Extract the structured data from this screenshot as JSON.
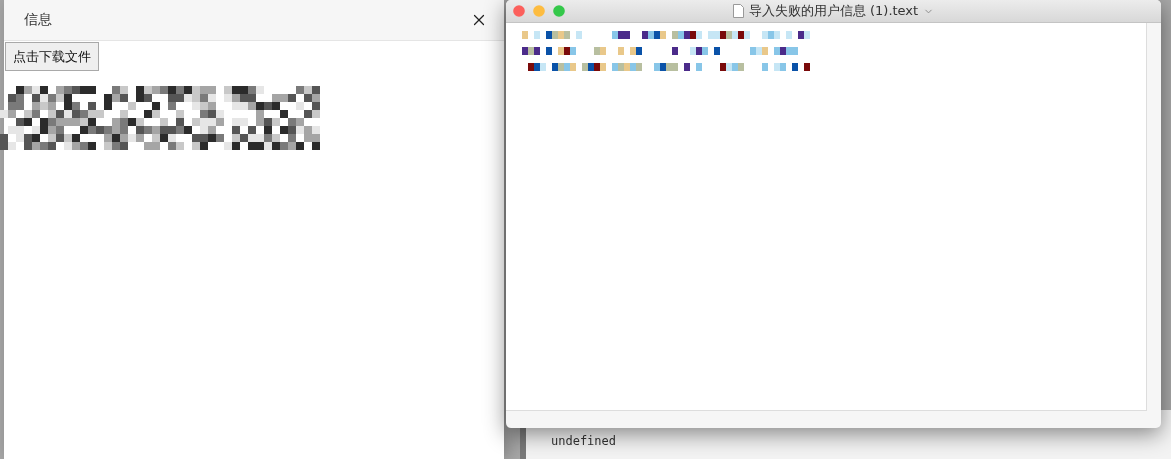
{
  "dialog": {
    "title": "信息",
    "download_button": "点击下载文件"
  },
  "text_window": {
    "title": "导入失败的用户信息 (1).text"
  },
  "console": {
    "lines": [
      "undefined"
    ]
  }
}
